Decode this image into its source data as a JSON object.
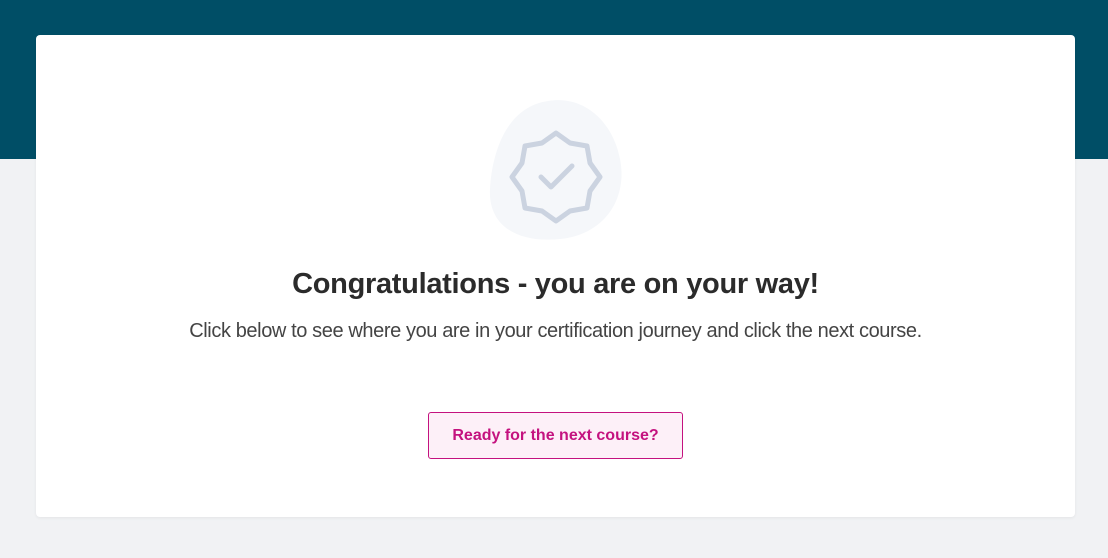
{
  "page": {
    "heading": "Congratulations - you are on your way!",
    "subtext": "Click below to see where you are in your certification journey and click the next course.",
    "cta_label": "Ready for the next course?"
  },
  "icons": {
    "badge": "verified-badge-icon"
  },
  "colors": {
    "header_band": "#004e66",
    "page_background": "#f1f2f4",
    "card_background": "#ffffff",
    "accent": "#c4127f",
    "button_fill": "#fdf0f8",
    "badge_stroke": "#cbd3e0",
    "badge_blob": "#f5f7fa"
  }
}
